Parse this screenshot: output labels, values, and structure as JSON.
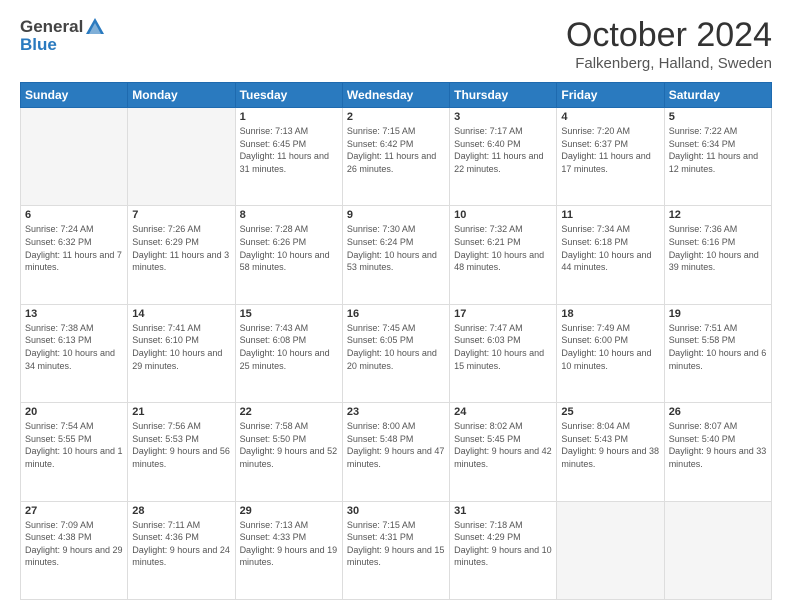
{
  "header": {
    "logo_general": "General",
    "logo_blue": "Blue",
    "month": "October 2024",
    "location": "Falkenberg, Halland, Sweden"
  },
  "days_of_week": [
    "Sunday",
    "Monday",
    "Tuesday",
    "Wednesday",
    "Thursday",
    "Friday",
    "Saturday"
  ],
  "weeks": [
    [
      {
        "day": "",
        "empty": true
      },
      {
        "day": "",
        "empty": true
      },
      {
        "day": "1",
        "sunrise": "Sunrise: 7:13 AM",
        "sunset": "Sunset: 6:45 PM",
        "daylight": "Daylight: 11 hours and 31 minutes."
      },
      {
        "day": "2",
        "sunrise": "Sunrise: 7:15 AM",
        "sunset": "Sunset: 6:42 PM",
        "daylight": "Daylight: 11 hours and 26 minutes."
      },
      {
        "day": "3",
        "sunrise": "Sunrise: 7:17 AM",
        "sunset": "Sunset: 6:40 PM",
        "daylight": "Daylight: 11 hours and 22 minutes."
      },
      {
        "day": "4",
        "sunrise": "Sunrise: 7:20 AM",
        "sunset": "Sunset: 6:37 PM",
        "daylight": "Daylight: 11 hours and 17 minutes."
      },
      {
        "day": "5",
        "sunrise": "Sunrise: 7:22 AM",
        "sunset": "Sunset: 6:34 PM",
        "daylight": "Daylight: 11 hours and 12 minutes."
      }
    ],
    [
      {
        "day": "6",
        "sunrise": "Sunrise: 7:24 AM",
        "sunset": "Sunset: 6:32 PM",
        "daylight": "Daylight: 11 hours and 7 minutes."
      },
      {
        "day": "7",
        "sunrise": "Sunrise: 7:26 AM",
        "sunset": "Sunset: 6:29 PM",
        "daylight": "Daylight: 11 hours and 3 minutes."
      },
      {
        "day": "8",
        "sunrise": "Sunrise: 7:28 AM",
        "sunset": "Sunset: 6:26 PM",
        "daylight": "Daylight: 10 hours and 58 minutes."
      },
      {
        "day": "9",
        "sunrise": "Sunrise: 7:30 AM",
        "sunset": "Sunset: 6:24 PM",
        "daylight": "Daylight: 10 hours and 53 minutes."
      },
      {
        "day": "10",
        "sunrise": "Sunrise: 7:32 AM",
        "sunset": "Sunset: 6:21 PM",
        "daylight": "Daylight: 10 hours and 48 minutes."
      },
      {
        "day": "11",
        "sunrise": "Sunrise: 7:34 AM",
        "sunset": "Sunset: 6:18 PM",
        "daylight": "Daylight: 10 hours and 44 minutes."
      },
      {
        "day": "12",
        "sunrise": "Sunrise: 7:36 AM",
        "sunset": "Sunset: 6:16 PM",
        "daylight": "Daylight: 10 hours and 39 minutes."
      }
    ],
    [
      {
        "day": "13",
        "sunrise": "Sunrise: 7:38 AM",
        "sunset": "Sunset: 6:13 PM",
        "daylight": "Daylight: 10 hours and 34 minutes."
      },
      {
        "day": "14",
        "sunrise": "Sunrise: 7:41 AM",
        "sunset": "Sunset: 6:10 PM",
        "daylight": "Daylight: 10 hours and 29 minutes."
      },
      {
        "day": "15",
        "sunrise": "Sunrise: 7:43 AM",
        "sunset": "Sunset: 6:08 PM",
        "daylight": "Daylight: 10 hours and 25 minutes."
      },
      {
        "day": "16",
        "sunrise": "Sunrise: 7:45 AM",
        "sunset": "Sunset: 6:05 PM",
        "daylight": "Daylight: 10 hours and 20 minutes."
      },
      {
        "day": "17",
        "sunrise": "Sunrise: 7:47 AM",
        "sunset": "Sunset: 6:03 PM",
        "daylight": "Daylight: 10 hours and 15 minutes."
      },
      {
        "day": "18",
        "sunrise": "Sunrise: 7:49 AM",
        "sunset": "Sunset: 6:00 PM",
        "daylight": "Daylight: 10 hours and 10 minutes."
      },
      {
        "day": "19",
        "sunrise": "Sunrise: 7:51 AM",
        "sunset": "Sunset: 5:58 PM",
        "daylight": "Daylight: 10 hours and 6 minutes."
      }
    ],
    [
      {
        "day": "20",
        "sunrise": "Sunrise: 7:54 AM",
        "sunset": "Sunset: 5:55 PM",
        "daylight": "Daylight: 10 hours and 1 minute."
      },
      {
        "day": "21",
        "sunrise": "Sunrise: 7:56 AM",
        "sunset": "Sunset: 5:53 PM",
        "daylight": "Daylight: 9 hours and 56 minutes."
      },
      {
        "day": "22",
        "sunrise": "Sunrise: 7:58 AM",
        "sunset": "Sunset: 5:50 PM",
        "daylight": "Daylight: 9 hours and 52 minutes."
      },
      {
        "day": "23",
        "sunrise": "Sunrise: 8:00 AM",
        "sunset": "Sunset: 5:48 PM",
        "daylight": "Daylight: 9 hours and 47 minutes."
      },
      {
        "day": "24",
        "sunrise": "Sunrise: 8:02 AM",
        "sunset": "Sunset: 5:45 PM",
        "daylight": "Daylight: 9 hours and 42 minutes."
      },
      {
        "day": "25",
        "sunrise": "Sunrise: 8:04 AM",
        "sunset": "Sunset: 5:43 PM",
        "daylight": "Daylight: 9 hours and 38 minutes."
      },
      {
        "day": "26",
        "sunrise": "Sunrise: 8:07 AM",
        "sunset": "Sunset: 5:40 PM",
        "daylight": "Daylight: 9 hours and 33 minutes."
      }
    ],
    [
      {
        "day": "27",
        "sunrise": "Sunrise: 7:09 AM",
        "sunset": "Sunset: 4:38 PM",
        "daylight": "Daylight: 9 hours and 29 minutes."
      },
      {
        "day": "28",
        "sunrise": "Sunrise: 7:11 AM",
        "sunset": "Sunset: 4:36 PM",
        "daylight": "Daylight: 9 hours and 24 minutes."
      },
      {
        "day": "29",
        "sunrise": "Sunrise: 7:13 AM",
        "sunset": "Sunset: 4:33 PM",
        "daylight": "Daylight: 9 hours and 19 minutes."
      },
      {
        "day": "30",
        "sunrise": "Sunrise: 7:15 AM",
        "sunset": "Sunset: 4:31 PM",
        "daylight": "Daylight: 9 hours and 15 minutes."
      },
      {
        "day": "31",
        "sunrise": "Sunrise: 7:18 AM",
        "sunset": "Sunset: 4:29 PM",
        "daylight": "Daylight: 9 hours and 10 minutes."
      },
      {
        "day": "",
        "empty": true
      },
      {
        "day": "",
        "empty": true
      }
    ]
  ]
}
